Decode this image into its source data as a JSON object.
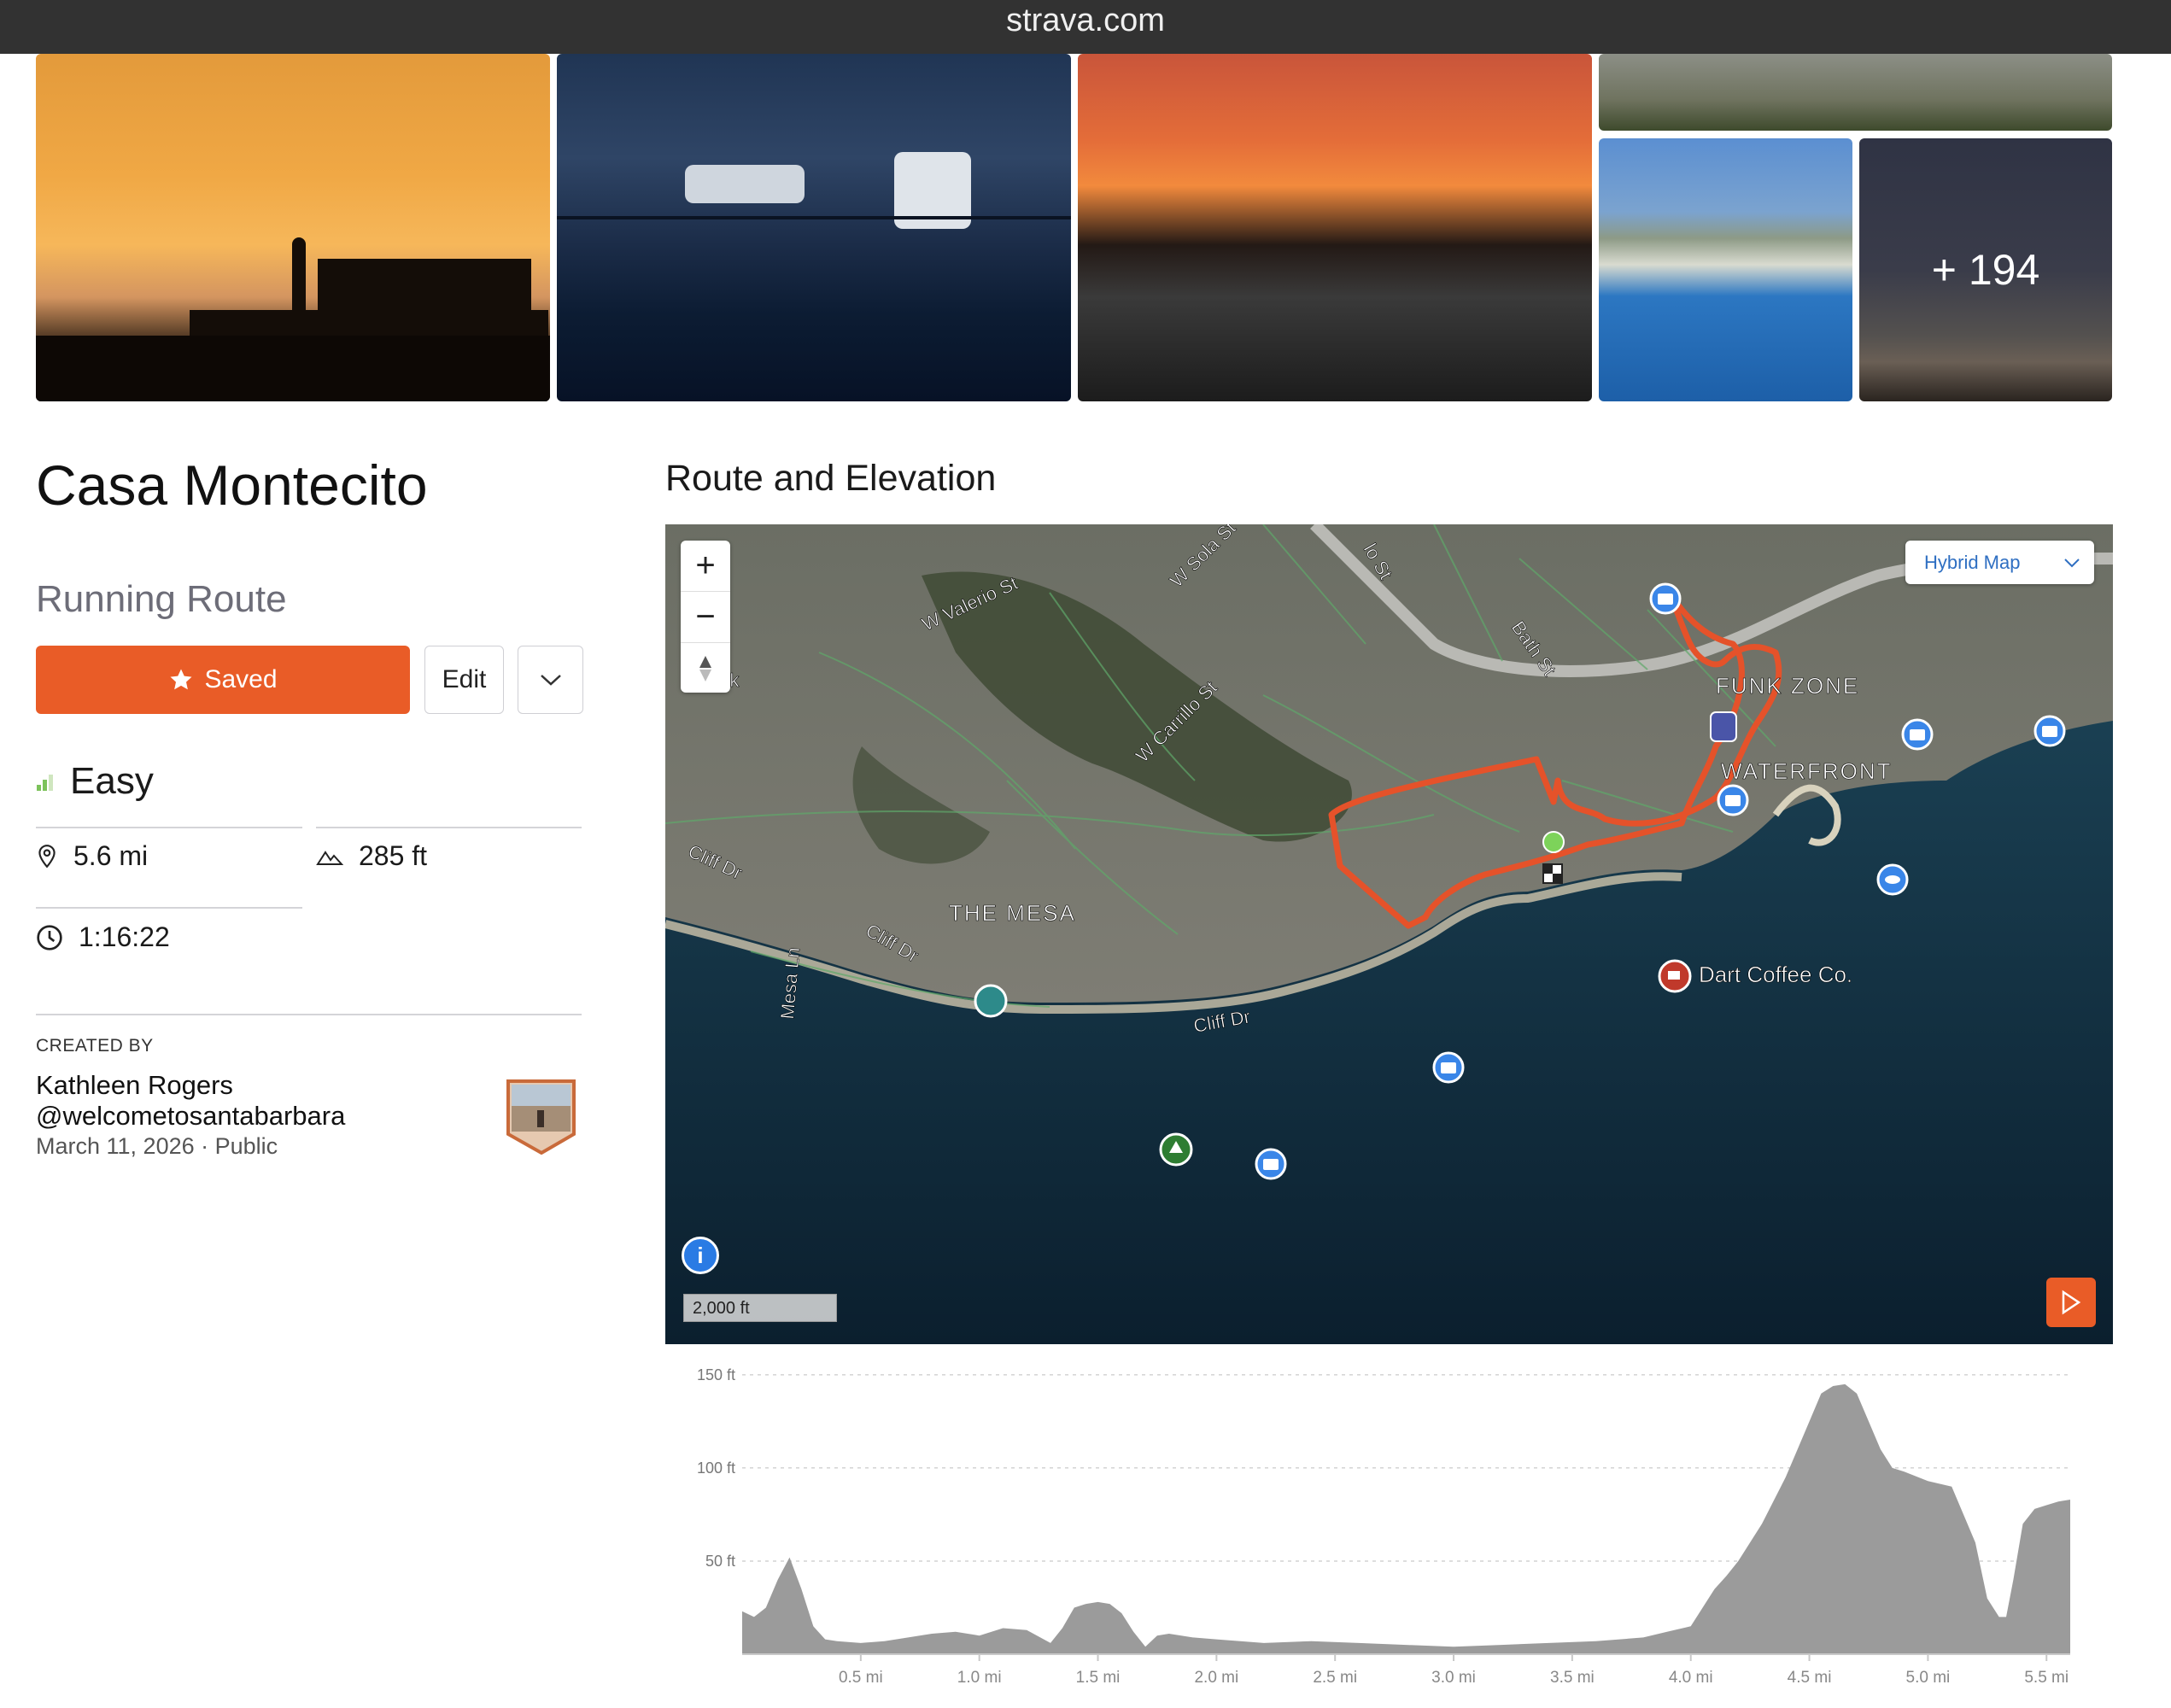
{
  "browser": {
    "url": "strava.com"
  },
  "photos": {
    "more_label": "+ 194"
  },
  "route": {
    "title": "Casa Montecito",
    "type_label": "Running Route",
    "saved_label": "Saved",
    "edit_label": "Edit",
    "difficulty": "Easy",
    "distance": "5.6 mi",
    "elevation_gain": "285 ft",
    "duration": "1:16:22"
  },
  "creator": {
    "label": "CREATED BY",
    "name": "Kathleen Rogers",
    "handle": "@welcometosantabarbara",
    "date": "March 11, 2026",
    "visibility": "Public"
  },
  "map": {
    "section_title": "Route and Elevation",
    "map_type": "Hybrid Map",
    "scale_label": "2,000 ft",
    "info_label": "i",
    "labels": {
      "funk_zone": "FUNK ZONE",
      "waterfront": "WATERFRONT",
      "the_mesa": "THE MESA",
      "dart_coffee": "Dart Coffee Co.",
      "w_valerio": "W Valerio St",
      "w_sola": "W Sola St",
      "bath": "Bath St",
      "w_carrillo": "W Carrillo St",
      "cliff_dr_1": "Cliff Dr",
      "cliff_dr_2": "Cliff Dr",
      "cliff_dr_3": "Cliff Dr",
      "mesa_ln": "Mesa Ln",
      "park_fragment": "rk",
      "st_fragment": "lo St"
    },
    "colors": {
      "route": "#e5522a",
      "pin": "#3a86e8",
      "accent": "#e95c27"
    }
  },
  "chart_data": {
    "type": "area",
    "ylabel": "",
    "xlabel": "",
    "y_ticks": [
      "150 ft",
      "100 ft",
      "50 ft"
    ],
    "y_tick_values": [
      150,
      100,
      50
    ],
    "x_ticks": [
      "0.5 mi",
      "1.0 mi",
      "1.5 mi",
      "2.0 mi",
      "2.5 mi",
      "3.0 mi",
      "3.5 mi",
      "4.0 mi",
      "4.5 mi",
      "5.0 mi",
      "5.5 mi"
    ],
    "x_tick_values": [
      0.5,
      1.0,
      1.5,
      2.0,
      2.5,
      3.0,
      3.5,
      4.0,
      4.5,
      5.0,
      5.5
    ],
    "xlim": [
      0,
      5.6
    ],
    "ylim": [
      0,
      155
    ],
    "color": "#9b9b9b",
    "x": [
      0,
      0.05,
      0.1,
      0.15,
      0.2,
      0.25,
      0.3,
      0.35,
      0.4,
      0.5,
      0.6,
      0.7,
      0.8,
      0.9,
      1.0,
      1.1,
      1.2,
      1.3,
      1.35,
      1.4,
      1.45,
      1.5,
      1.55,
      1.6,
      1.65,
      1.7,
      1.75,
      1.8,
      1.9,
      2.0,
      2.2,
      2.4,
      2.6,
      2.8,
      3.0,
      3.2,
      3.4,
      3.6,
      3.7,
      3.8,
      3.9,
      4.0,
      4.05,
      4.1,
      4.15,
      4.2,
      4.3,
      4.4,
      4.45,
      4.5,
      4.55,
      4.6,
      4.65,
      4.7,
      4.75,
      4.8,
      4.85,
      4.9,
      5.0,
      5.1,
      5.2,
      5.25,
      5.3,
      5.33,
      5.36,
      5.4,
      5.45,
      5.5,
      5.55,
      5.6
    ],
    "y": [
      23,
      20,
      25,
      40,
      52,
      35,
      15,
      8,
      7,
      6,
      7,
      9,
      11,
      12,
      10,
      14,
      13,
      6,
      14,
      25,
      27,
      28,
      27,
      22,
      12,
      4,
      10,
      11,
      9,
      8,
      6,
      7,
      6,
      5,
      4,
      5,
      6,
      7,
      8,
      9,
      12,
      15,
      25,
      35,
      42,
      50,
      70,
      95,
      110,
      125,
      140,
      144,
      145,
      140,
      125,
      110,
      100,
      98,
      93,
      90,
      60,
      30,
      20,
      20,
      40,
      70,
      78,
      80,
      82,
      83
    ]
  }
}
